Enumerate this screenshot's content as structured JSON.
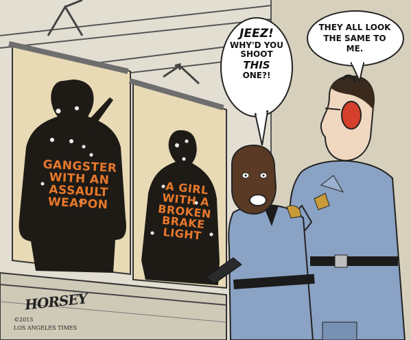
{
  "cartoon": {
    "gangster_target": "GANGSTER WITH AN ASSAULT WEAPON",
    "girl_target": "A GIRL WITH A BROKEN BRAKE LIGHT",
    "bubble_jeez": {
      "line1": "JEEZ!",
      "line2": "WHY'D YOU",
      "line3": "SHOOT",
      "line4": "THIS",
      "line5": "ONE?!"
    },
    "bubble_same": "THEY ALL LOOK THE SAME TO ME.",
    "signature": "HORSEY",
    "copyright": "©2015",
    "publisher": "LOS ANGELES TIMES"
  },
  "colors": {
    "target_text": "#e8782a",
    "silhouette": "#1e1b17",
    "paper": "#e6d8b4",
    "uniform": "#8aa2c4",
    "wall": "#dcd6c6"
  }
}
